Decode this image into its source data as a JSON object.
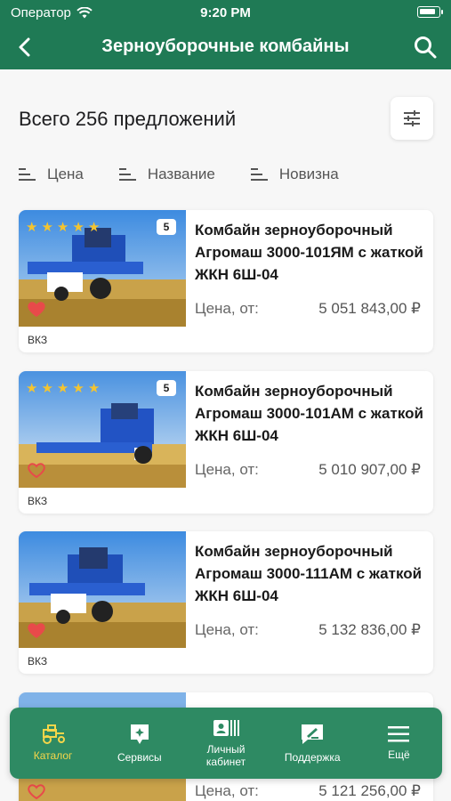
{
  "status": {
    "carrier": "Оператор",
    "time": "9:20 PM"
  },
  "header": {
    "title": "Зерноуборочные комбайны"
  },
  "summary": {
    "total": "Всего 256 предложений"
  },
  "sort": [
    {
      "label": "Цена"
    },
    {
      "label": "Название"
    },
    {
      "label": "Новизна"
    }
  ],
  "products": [
    {
      "name": "Комбайн зерноуборочный Агромаш 3000-101ЯМ с жаткой ЖКН 6Ш-04",
      "price_label": "Цена, от:",
      "price": "5 051 843,00 ₽",
      "rating_count": "5",
      "seller": "ВКЗ",
      "favorite": true
    },
    {
      "name": "Комбайн зерноуборочный Агромаш 3000-101АМ с жаткой ЖКН 6Ш-04",
      "price_label": "Цена, от:",
      "price": "5 010 907,00 ₽",
      "rating_count": "5",
      "seller": "ВКЗ",
      "favorite": false
    },
    {
      "name": "Комбайн зерноуборочный Агромаш 3000-111АМ с жаткой ЖКН 6Ш-04",
      "price_label": "Цена, от:",
      "price": "5 132 836,00 ₽",
      "rating_count": "",
      "seller": "ВКЗ",
      "favorite": true
    },
    {
      "name": "",
      "price_label": "Цена, от:",
      "price": "5 121 256,00 ₽",
      "rating_count": "",
      "seller": "",
      "favorite": false
    }
  ],
  "tabbar": [
    {
      "label": "Каталог",
      "icon": "tractor-icon",
      "active": true
    },
    {
      "label": "Сервисы",
      "icon": "services-icon",
      "active": false
    },
    {
      "label": "Личный\nкабинет",
      "icon": "profile-card-icon",
      "active": false
    },
    {
      "label": "Поддержка",
      "icon": "support-chat-icon",
      "active": false
    },
    {
      "label": "Ещё",
      "icon": "menu-icon",
      "active": false
    }
  ],
  "colors": {
    "brand": "#1f7a55",
    "tab_active": "#f5d64a",
    "heart": "#e84a4a",
    "star": "#f4c430"
  }
}
